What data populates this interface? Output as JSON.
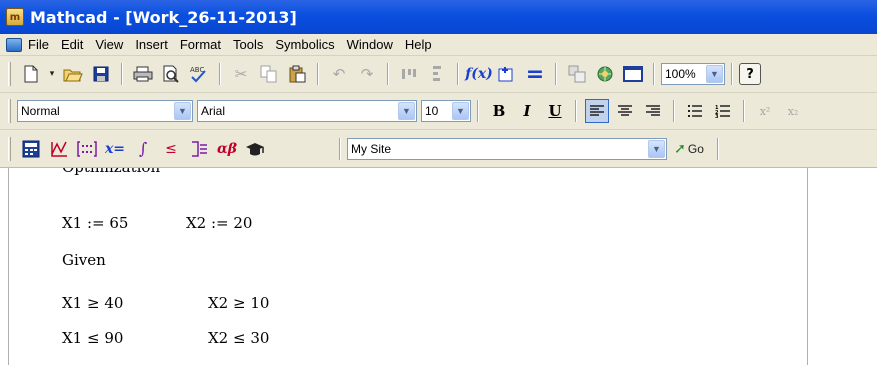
{
  "window": {
    "title": "Mathcad - [Work_26-11-2013]"
  },
  "menubar": {
    "items": [
      "File",
      "Edit",
      "View",
      "Insert",
      "Format",
      "Tools",
      "Symbolics",
      "Window",
      "Help"
    ]
  },
  "standard_toolbar": {
    "buttons": [
      {
        "name": "new-icon"
      },
      {
        "name": "new-dropdown-icon"
      },
      {
        "name": "open-icon"
      },
      {
        "name": "save-icon"
      },
      {
        "name": "print-icon"
      },
      {
        "name": "print-preview-icon"
      },
      {
        "name": "spellcheck-icon"
      },
      {
        "name": "cut-icon"
      },
      {
        "name": "copy-icon"
      },
      {
        "name": "paste-icon"
      },
      {
        "name": "undo-icon"
      },
      {
        "name": "redo-icon"
      },
      {
        "name": "align-across-icon"
      },
      {
        "name": "align-down-icon"
      },
      {
        "name": "insert-function-icon"
      },
      {
        "name": "insert-unit-icon"
      },
      {
        "name": "calculate-icon"
      },
      {
        "name": "insert-component-icon"
      },
      {
        "name": "resources-icon"
      },
      {
        "name": "insert-region-icon"
      }
    ],
    "zoom": "100%",
    "help_label": "?"
  },
  "formatting_toolbar": {
    "style": "Normal",
    "font": "Arial",
    "size": "10",
    "bold": "B",
    "italic": "I",
    "underline": "U",
    "superscript": "x²",
    "subscript": "x₂"
  },
  "math_toolbar": {
    "url": "My Site",
    "go_label": "Go"
  },
  "worksheet": {
    "heading_partial": "Optimization",
    "lines": [
      {
        "id": "x1-init",
        "text": "X1 := 65"
      },
      {
        "id": "x2-init",
        "text": "X2 := 20"
      },
      {
        "id": "given",
        "text": "Given"
      },
      {
        "id": "x1-min",
        "text": "X1 ≥ 40"
      },
      {
        "id": "x2-min",
        "text": "X2 ≥ 10"
      },
      {
        "id": "x1-max",
        "text": "X1 ≤ 90"
      },
      {
        "id": "x2-max",
        "text": "X2 ≤ 30"
      }
    ]
  },
  "colors": {
    "titlebar": "#0a4fe0",
    "chrome": "#ece9d8",
    "accent_red": "#c0002a",
    "accent_blue": "#1a3fcf"
  }
}
